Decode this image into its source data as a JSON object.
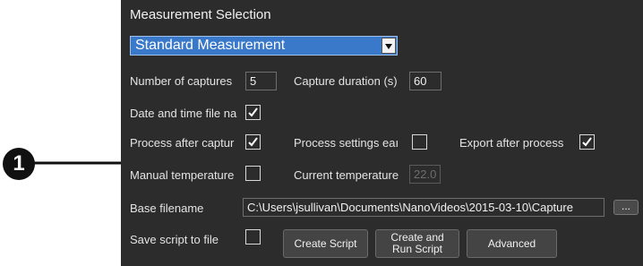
{
  "title": "Measurement Selection",
  "measurement_dropdown": {
    "selected": "Standard Measurement"
  },
  "captures": {
    "label": "Number of captures",
    "value": "5"
  },
  "duration": {
    "label": "Capture duration (s)",
    "value": "60"
  },
  "date_time": {
    "label": "Date and time file na",
    "checked": true
  },
  "process_after": {
    "label": "Process after captur",
    "checked": true
  },
  "process_settings": {
    "label": "Process settings eaı",
    "checked": false
  },
  "export_after": {
    "label": "Export after process",
    "checked": true
  },
  "manual_temp": {
    "label": "Manual temperature",
    "checked": false
  },
  "current_temp": {
    "label": "Current temperature",
    "value": "22.0"
  },
  "base_filename": {
    "label": "Base filename",
    "value": "C:\\Users\\jsullivan\\Documents\\NanoVideos\\2015-03-10\\Capture",
    "browse_label": "..."
  },
  "save_script": {
    "label": "Save script to file",
    "checked": false
  },
  "buttons": {
    "create_script": "Create Script",
    "create_and_run": "Create and Run Script",
    "advanced": "Advanced"
  },
  "callout": {
    "number": "1"
  },
  "colors": {
    "panel_bg": "#2c2c2c",
    "dropdown_bg": "#3a78c9",
    "text": "#e4e4e4"
  }
}
